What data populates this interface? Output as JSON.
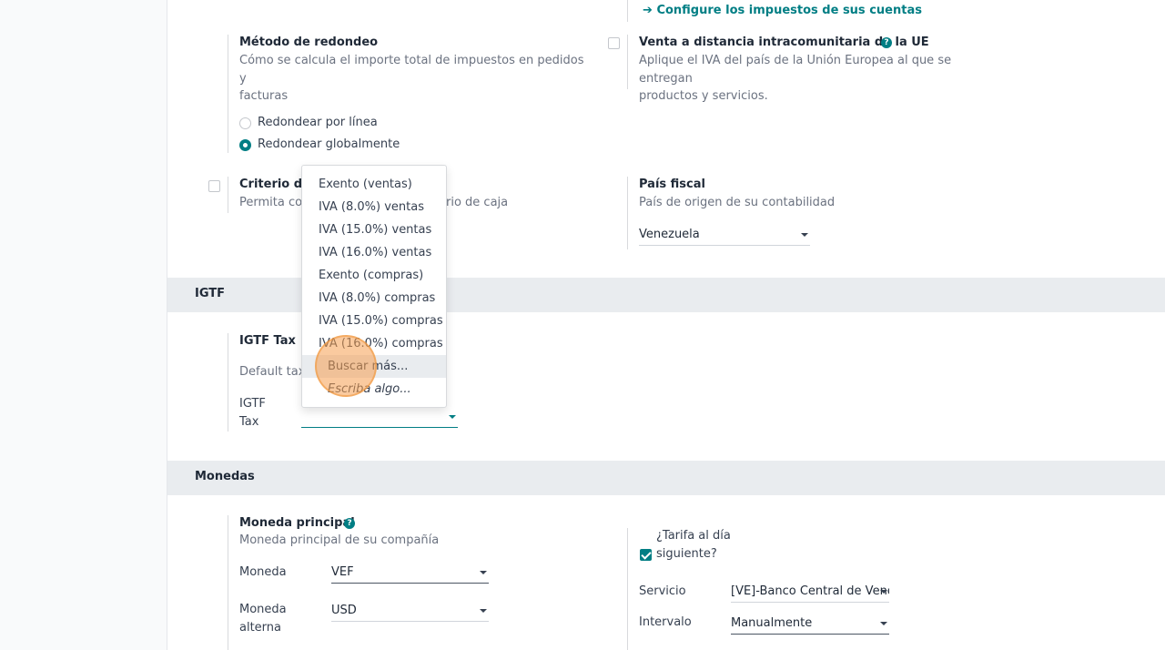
{
  "taxes_section": {
    "configure_link": "Configure los impuestos de sus cuentas",
    "rounding": {
      "title": "Método de redondeo",
      "desc_line1": "Cómo se calcula el importe total de impuestos en pedidos y",
      "desc_line2": "facturas",
      "option_line": "Redondear por línea",
      "option_global": "Redondear globalmente",
      "selected": "Redondear globalmente"
    },
    "eu_distance": {
      "title": "Venta a distancia intracomunitaria de la UE",
      "help": "?",
      "desc_line1": "Aplique el IVA del país de la Unión Europea al que se entregan",
      "desc_line2": "productos y servicios."
    },
    "cash_basis": {
      "title": "Criterio de",
      "desc_start": "Permita cor",
      "desc_end": "rio de caja"
    },
    "fiscal_country": {
      "title": "País fiscal",
      "desc": "País de origen de su contabilidad",
      "value": "Venezuela"
    }
  },
  "igtf_section": {
    "title": "IGTF",
    "tax_title": "IGTF Tax",
    "tax_desc": "Default tax",
    "field_label_1": "IGTF",
    "field_label_2": "Tax",
    "field_value": ""
  },
  "dropdown": {
    "items": [
      "Exento (ventas)",
      "IVA (8.0%) ventas",
      "IVA (15.0%) ventas",
      "IVA (16.0%) ventas",
      "Exento (compras)",
      "IVA (8.0%) compras",
      "IVA (15.0%) compras",
      "IVA (16.0%) compras"
    ],
    "search_more": "Buscar más...",
    "type_something": "Escriba algo..."
  },
  "currency_section": {
    "title": "Monedas",
    "main_currency": {
      "title": "Moneda principal",
      "help": "?",
      "desc": "Moneda principal de su compañía",
      "currency_label": "Moneda",
      "currency_value": "VEF",
      "alt_label_1": "Moneda",
      "alt_label_2": "alterna",
      "alt_value": "USD"
    },
    "rate": {
      "next_day_1": "¿Tarifa al día",
      "next_day_2": "siguiente?",
      "next_day_checked": true,
      "service_label": "Servicio",
      "service_value": "[VE]-Banco Central de Venezuela",
      "interval_label": "Intervalo",
      "interval_value": "Manualmente"
    }
  },
  "colors": {
    "accent": "#017e84",
    "section_band": "#e9ecef",
    "cursor_highlight": "#f59e50"
  }
}
